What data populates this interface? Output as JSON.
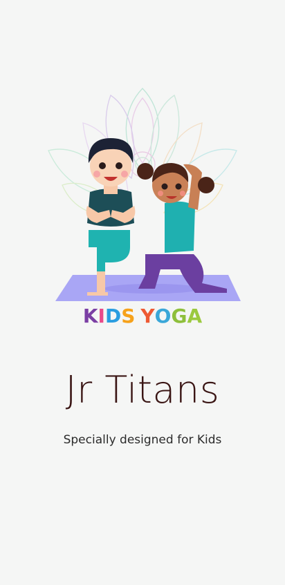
{
  "splash": {
    "logo": {
      "letters": [
        "K",
        "I",
        "D",
        "S",
        "Y",
        "O",
        "G",
        "A"
      ],
      "colors": [
        "#7b3fa4",
        "#e94a8a",
        "#2a9de0",
        "#f6a21b",
        "#ee5a33",
        "#3aa7d8",
        "#8ebf3b",
        "#9bc93e"
      ]
    },
    "title": "Jr Titans",
    "subtitle": "Specially designed for Kids"
  }
}
